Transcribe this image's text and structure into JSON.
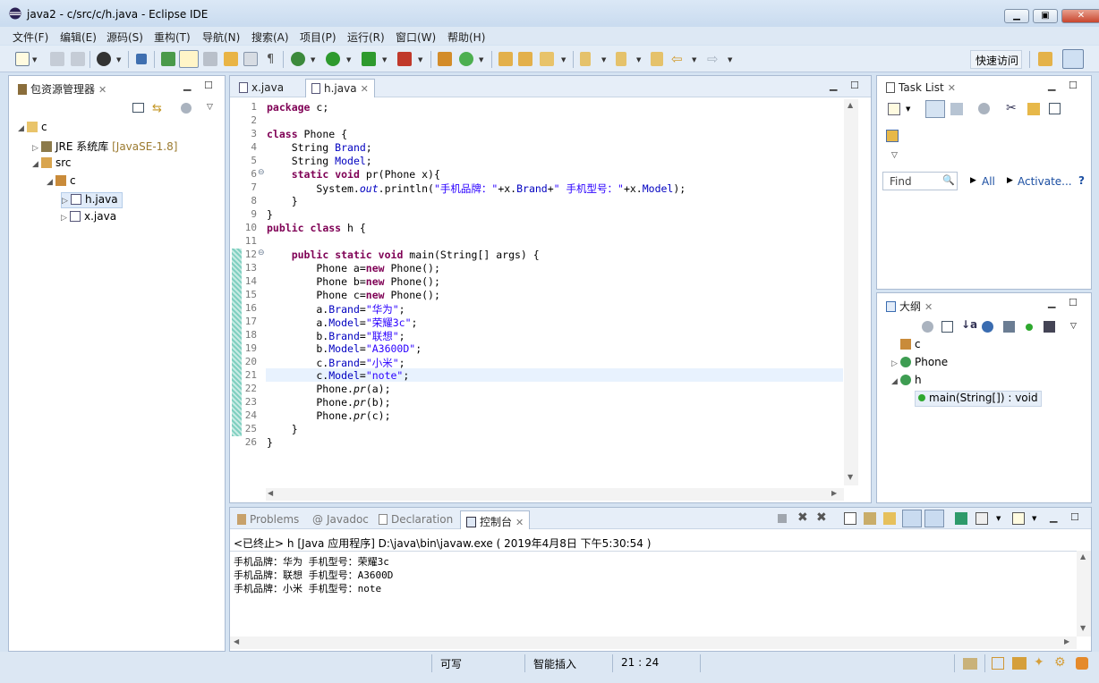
{
  "window": {
    "title": "java2 - c/src/c/h.java - Eclipse IDE"
  },
  "menu": [
    "文件(F)",
    "编辑(E)",
    "源码(S)",
    "重构(T)",
    "导航(N)",
    "搜索(A)",
    "项目(P)",
    "运行(R)",
    "窗口(W)",
    "帮助(H)"
  ],
  "quick_access": "快速访问",
  "package_explorer": {
    "tab": "包资源管理器",
    "project": "c",
    "jre": "JRE 系统库",
    "jre_version": "[JavaSE-1.8]",
    "src": "src",
    "package": "c",
    "files": [
      "h.java",
      "x.java"
    ]
  },
  "editor": {
    "tabs": [
      "x.java",
      "h.java"
    ],
    "lines": [
      {
        "n": "1",
        "html": "<span class='kw'>package</span> c;"
      },
      {
        "n": "2",
        "html": ""
      },
      {
        "n": "3",
        "html": "<span class='kw'>class</span> Phone {"
      },
      {
        "n": "4",
        "html": "    String <span class='fld'>Brand</span>;"
      },
      {
        "n": "5",
        "html": "    String <span class='fld'>Model</span>;"
      },
      {
        "n": "6",
        "html": "    <span class='kw'>static</span> <span class='kw'>void</span> pr(Phone x){"
      },
      {
        "n": "7",
        "html": "        System.<span class='sta'>out</span>.println(<span class='str'>\"手机品牌：\"</span>+x.<span class='fld'>Brand</span>+<span class='str'>\" 手机型号：\"</span>+x.<span class='fld'>Model</span>);"
      },
      {
        "n": "8",
        "html": "    }"
      },
      {
        "n": "9",
        "html": "}"
      },
      {
        "n": "10",
        "html": "<span class='kw'>public</span> <span class='kw'>class</span> h {"
      },
      {
        "n": "11",
        "html": ""
      },
      {
        "n": "12",
        "html": "    <span class='kw'>public</span> <span class='kw'>static</span> <span class='kw'>void</span> main(String[] args) {"
      },
      {
        "n": "13",
        "html": "        Phone a=<span class='kw'>new</span> Phone();"
      },
      {
        "n": "14",
        "html": "        Phone b=<span class='kw'>new</span> Phone();"
      },
      {
        "n": "15",
        "html": "        Phone c=<span class='kw'>new</span> Phone();"
      },
      {
        "n": "16",
        "html": "        a.<span class='fld'>Brand</span>=<span class='str'>\"华为\"</span>;"
      },
      {
        "n": "17",
        "html": "        a.<span class='fld'>Model</span>=<span class='str'>\"荣耀3c\"</span>;"
      },
      {
        "n": "18",
        "html": "        b.<span class='fld'>Brand</span>=<span class='str'>\"联想\"</span>;"
      },
      {
        "n": "19",
        "html": "        b.<span class='fld'>Model</span>=<span class='str'>\"A3600D\"</span>;"
      },
      {
        "n": "20",
        "html": "        c.<span class='fld'>Brand</span>=<span class='str'>\"小米\"</span>;"
      },
      {
        "n": "21",
        "html": "        c.<span class='fld'>Model</span>=<span class='str'>\"note\"</span>;"
      },
      {
        "n": "22",
        "html": "        Phone.<span class='it'>pr</span>(a);"
      },
      {
        "n": "23",
        "html": "        Phone.<span class='it'>pr</span>(b);"
      },
      {
        "n": "24",
        "html": "        Phone.<span class='it'>pr</span>(c);"
      },
      {
        "n": "25",
        "html": "    }"
      },
      {
        "n": "26",
        "html": "}"
      }
    ]
  },
  "task_list": {
    "tab": "Task List",
    "find_placeholder": "Find",
    "all": "All",
    "activate": "Activate...",
    "help": "?"
  },
  "outline": {
    "tab": "大纲",
    "items": [
      "c",
      "Phone",
      "h",
      "main(String[]) : void"
    ]
  },
  "console_panel": {
    "tabs": [
      "Problems",
      "Javadoc",
      "Declaration",
      "控制台"
    ],
    "header": "<已终止> h [Java 应用程序] D:\\java\\bin\\javaw.exe ( 2019年4月8日 下午5:30:54 )",
    "output": [
      "手机品牌：华为 手机型号：荣耀3c",
      "手机品牌：联想 手机型号：A3600D",
      "手机品牌：小米 手机型号：note"
    ]
  },
  "status": {
    "writable": "可写",
    "insert_mode": "智能插入",
    "position": "21 : 24"
  }
}
